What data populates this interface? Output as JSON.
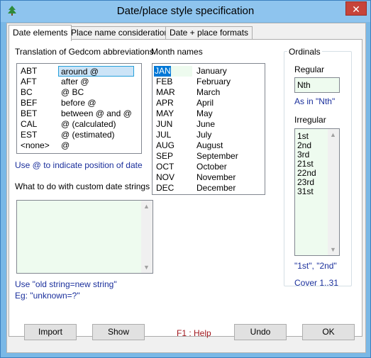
{
  "window": {
    "title": "Date/place style specification",
    "close": "✕"
  },
  "tabs": [
    {
      "label": "Date elements"
    },
    {
      "label": "Place name considerations"
    },
    {
      "label": "Date + place formats"
    }
  ],
  "gedcom": {
    "header": "Translation of Gedcom abbreviations",
    "rows": [
      {
        "abbr": "ABT",
        "value": "around @"
      },
      {
        "abbr": "AFT",
        "value": "after @"
      },
      {
        "abbr": "BC",
        "value": "@ BC"
      },
      {
        "abbr": "BEF",
        "value": "before @"
      },
      {
        "abbr": "BET",
        "value": "between @ and @"
      },
      {
        "abbr": "CAL",
        "value": "@ (calculated)"
      },
      {
        "abbr": "EST",
        "value": "@ (estimated)"
      },
      {
        "abbr": "<none>",
        "value": "@"
      }
    ],
    "hint": "Use @ to indicate position of date"
  },
  "custom": {
    "header": "What to do with custom date strings",
    "hint1": "Use \"old string=new string\"",
    "hint2": "Eg: \"unknown=?\""
  },
  "months": {
    "header": "Month names",
    "rows": [
      {
        "abbr": "JAN",
        "name": "January"
      },
      {
        "abbr": "FEB",
        "name": "February"
      },
      {
        "abbr": "MAR",
        "name": "March"
      },
      {
        "abbr": "APR",
        "name": "April"
      },
      {
        "abbr": "MAY",
        "name": "May"
      },
      {
        "abbr": "JUN",
        "name": "June"
      },
      {
        "abbr": "JUL",
        "name": "July"
      },
      {
        "abbr": "AUG",
        "name": "August"
      },
      {
        "abbr": "SEP",
        "name": "September"
      },
      {
        "abbr": "OCT",
        "name": "October"
      },
      {
        "abbr": "NOV",
        "name": "November"
      },
      {
        "abbr": "DEC",
        "name": "December"
      }
    ]
  },
  "ordinals": {
    "header": "Ordinals",
    "regular_label": "Regular",
    "regular_value": "Nth",
    "regular_hint": "As in \"Nth\"",
    "irregular_label": "Irregular",
    "irregular_items": [
      "1st",
      "2nd",
      "3rd",
      "21st",
      "22nd",
      "23rd",
      "31st"
    ],
    "irregular_hint": "\"1st\", \"2nd\"",
    "cover": "Cover 1..31"
  },
  "buttons": {
    "import": "Import",
    "show": "Show",
    "f1": "F1 : Help",
    "undo": "Undo",
    "ok": "OK"
  },
  "colors": {
    "hint_text": "#1a2f9c",
    "help_text": "#a1171d",
    "selection": "#0078d7"
  }
}
